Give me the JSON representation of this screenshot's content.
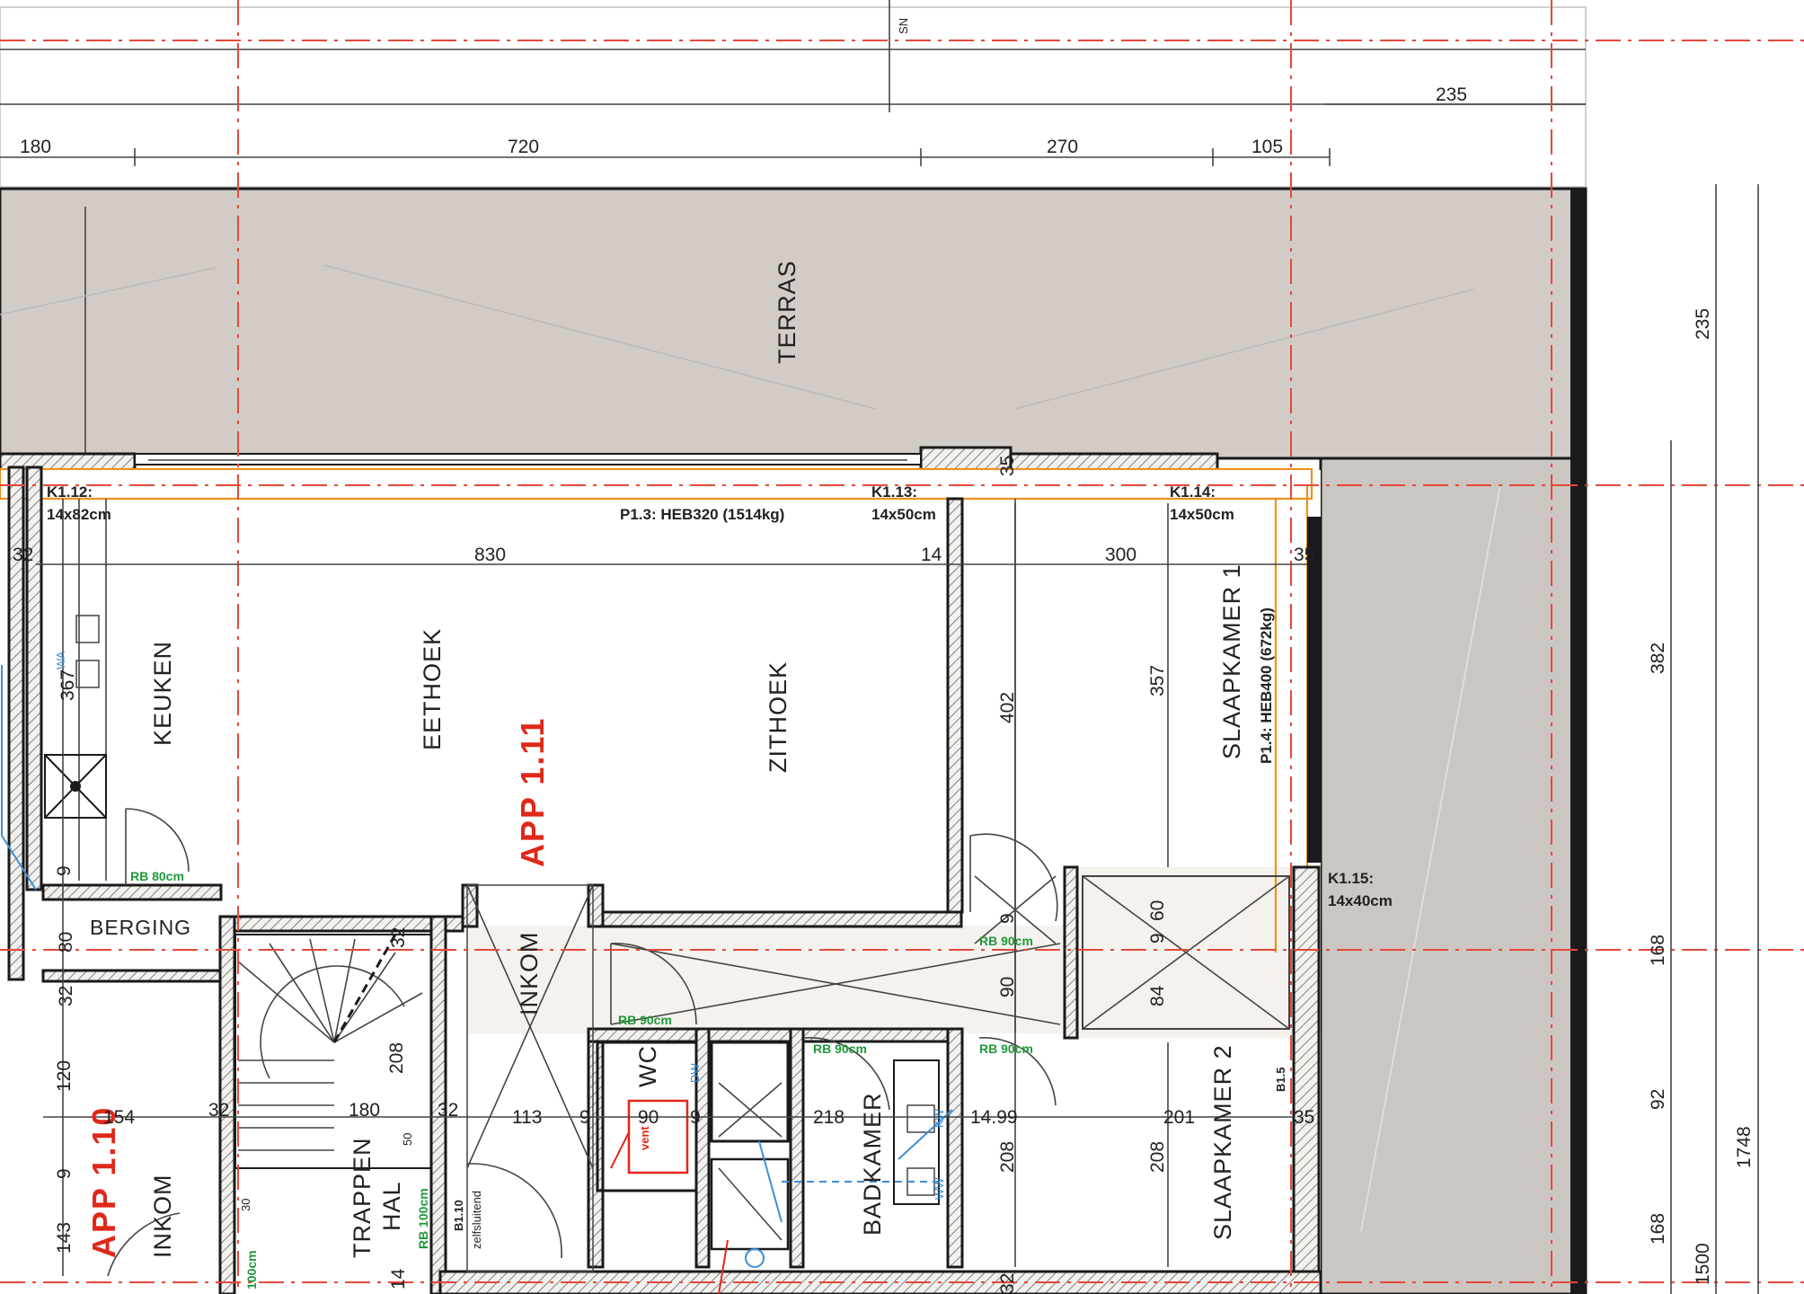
{
  "colors": {
    "terrace_fill": "#d3ccc6",
    "floor_fill": "#ffffff",
    "gray_zone": "#cbc6c1",
    "grid_line": "#e5483a",
    "beam_line": "#f0901e",
    "plumbing": "#3a8fd8",
    "app_label": "#e02818",
    "door_label": "#1f9a3a"
  },
  "labels": {
    "sn": "SN",
    "terras": "TERRAS",
    "keuken": "KEUKEN",
    "eethoek": "EETHOEK",
    "app111": "APP 1.11",
    "zithoek": "ZITHOEK",
    "slaapkamer1": "SLAAPKAMER 1",
    "berging": "BERGING",
    "inkom_main": "INKOM",
    "wc": "WC",
    "badkamer": "BADKAMER",
    "slaapkamer2": "SLAAPKAMER 2",
    "app110": "APP 1.10",
    "inkom_left": "INKOM",
    "trappen": "TRAPPEN",
    "hal": "HAL"
  },
  "beams": {
    "k112_a": "K1.12:",
    "k112_b": "14x82cm",
    "p13": "P1.3: HEB320 (1514kg)",
    "k113_a": "K1.13:",
    "k113_b": "14x50cm",
    "k114_a": "K1.14:",
    "k114_b": "14x50cm",
    "p14": "P1.4: HEB400 (672kg)",
    "k115_a": "K1.15:",
    "k115_b": "14x40cm"
  },
  "doors": {
    "rb80": "RB 80cm",
    "rb90_a": "RB 90cm",
    "rb90_b": "RB 90cm",
    "rb90_c": "RB 90cm",
    "rb90_d": "RB 90cm",
    "rb100": "RB 100cm",
    "cm100": "100cm"
  },
  "dims_top": {
    "d180": "180",
    "d720": "720",
    "d270": "270",
    "d105": "105",
    "d235": "235"
  },
  "dims_inner": {
    "d32a": "32",
    "d830": "830",
    "d14": "14",
    "d300": "300",
    "d35a": "35",
    "d35b": "35",
    "d35c": "35",
    "d367": "367",
    "d402": "402",
    "d357": "357",
    "d9a": "9",
    "d60": "60",
    "d9b": "9",
    "d9c": "9",
    "d80": "80",
    "d32b": "32",
    "d32c": "32",
    "d90": "90",
    "d84": "84",
    "d120": "120",
    "d154": "154",
    "d32d": "32",
    "d180b": "180",
    "d32e": "32",
    "d113": "113",
    "d9d": "9",
    "d90b": "90",
    "d9e": "9",
    "d218": "218",
    "d14_99": "14.99",
    "d201": "201",
    "d208a": "208",
    "d208b": "208",
    "d208c": "208",
    "d9f": "9",
    "d143": "143",
    "d14b": "14",
    "d32f": "32",
    "d50": "50",
    "d30": "30"
  },
  "dims_right": {
    "r235": "235",
    "r382": "382",
    "r168a": "168",
    "r92": "92",
    "r168b": "168",
    "r1748": "1748",
    "r1500": "1500"
  },
  "fixtures": {
    "vent": "vent",
    "dw": "DW",
    "kw": "KW",
    "ww": "WW",
    "wa": "WA",
    "b15": "B1.5",
    "b10": "B1.10",
    "zelfsluitend": "zelfsluitend"
  }
}
